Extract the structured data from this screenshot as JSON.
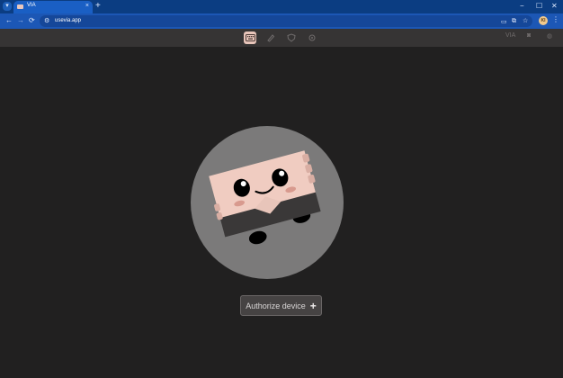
{
  "browser": {
    "tab_title": "VIA",
    "url": "usevia.app",
    "profile_initials": "KI",
    "tab_close": "×",
    "new_tab": "+",
    "minimize": "−",
    "maximize": "☐",
    "close": "✕",
    "back": "←",
    "forward": "→",
    "reload": "⟳",
    "menu": "⋮"
  },
  "app_header": {
    "nav_items": [
      "configure",
      "design",
      "test",
      "settings"
    ],
    "active": "configure",
    "brand_text": "VIA"
  },
  "main": {
    "authorize_label": "Authorize device",
    "authorize_icon": "+"
  },
  "colors": {
    "background": "#212020",
    "header": "#363434",
    "accent": "#e8c5ba",
    "chrome_blue": "#1c57b5"
  }
}
